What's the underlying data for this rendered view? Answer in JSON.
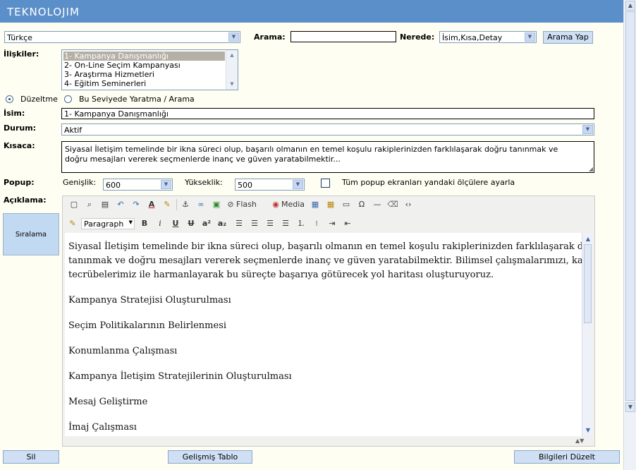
{
  "header": {
    "logo": "TEKNOLOJIM"
  },
  "language": {
    "selected": "Türkçe"
  },
  "search": {
    "label": "Arama:",
    "value": "",
    "where_label": "Nerede:",
    "where_value": "İsim,Kısa,Detay",
    "button": "Arama Yap"
  },
  "relations": {
    "label": "İlişkiler:",
    "items": [
      "1- Kampanya Danışmanlığı",
      "2- On-Line Seçim Kampanyası",
      "3- Araştırma Hizmetleri",
      "4- Eğitim Seminerleri"
    ],
    "selected_index": 0
  },
  "mode": {
    "edit": "Düzeltme",
    "create": "Bu Seviyede Yaratma / Arama",
    "selected": "edit"
  },
  "form": {
    "name_label": "İsim:",
    "name_value": "1- Kampanya Danışmanlığı",
    "status_label": "Durum:",
    "status_value": "Aktif",
    "summary_label": "Kısaca:",
    "summary_line1": "Siyasal İletişim temelinde bir ikna süreci olup, başarılı olmanın en temel koşulu rakiplerinizden farklılaşarak doğru tanınmak ve",
    "summary_line2": "doğru mesajları vererek seçmenlerde inanç ve güven yaratabilmektir...",
    "popup_label": "Popup:",
    "width_label": "Genişlik:",
    "width_value": "600",
    "height_label": "Yükseklik:",
    "height_value": "500",
    "popup_all_label": "Tüm popup ekranları yandaki ölçülere ayarla",
    "popup_all_checked": false,
    "description_label": "Açıklama:"
  },
  "sidebar": {
    "sort_button": "Sıralama"
  },
  "editor": {
    "toolbar1": {
      "flash": "Flash",
      "media": "Media"
    },
    "format_select": "Paragraph",
    "content": {
      "intro_line1": "Siyasal İletişim temelinde bir ikna süreci olup, başarılı olmanın en temel koşulu rakiplerinizden farklılaşarak doğru",
      "intro_line2": "tanınmak ve doğru mesajları vererek seçmenlerde inanç ve güven yaratabilmektir. Bilimsel çalışmalarımızı, kampanya",
      "intro_line3": "tecrübelerimiz ile harmanlayarak bu süreçte başarıya götürecek yol haritası oluşturuyoruz.",
      "items": [
        "Kampanya Stratejisi Oluşturulması",
        "Seçim Politikalarının Belirlenmesi",
        "Konumlanma Çalışması",
        "Kampanya İletişim Stratejilerinin Oluşturulması",
        "Mesaj Geliştirme",
        "İmaj Çalışması"
      ]
    }
  },
  "footer": {
    "delete": "Sil",
    "advanced_table": "Gelişmiş Tablo",
    "update": "Bilgileri Düzelt"
  }
}
